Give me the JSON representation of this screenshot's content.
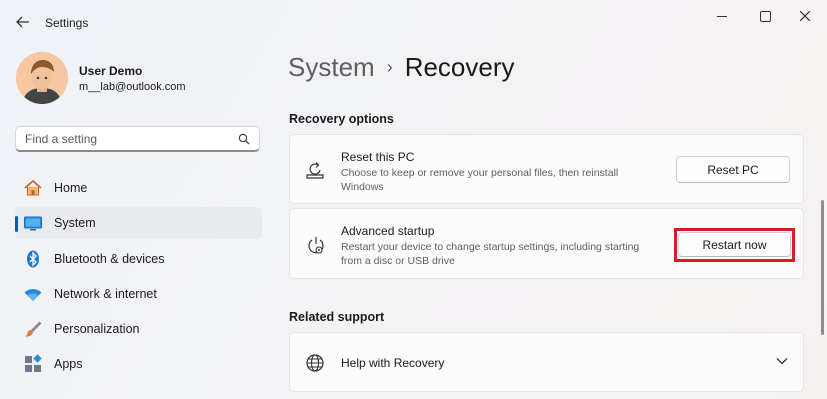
{
  "window": {
    "title": "Settings",
    "back_icon": "back-arrow-icon",
    "controls": [
      "minimize-icon",
      "maximize-icon",
      "close-icon"
    ]
  },
  "profile": {
    "name": "User Demo",
    "email": "m__lab@outlook.com"
  },
  "search": {
    "placeholder": "Find a setting",
    "value": "",
    "icon": "search-icon"
  },
  "sidebar": {
    "items": [
      {
        "label": "Home",
        "icon": "home-icon",
        "active": false
      },
      {
        "label": "System",
        "icon": "monitor-icon",
        "active": true
      },
      {
        "label": "Bluetooth & devices",
        "icon": "bluetooth-icon",
        "active": false
      },
      {
        "label": "Network & internet",
        "icon": "wifi-icon",
        "active": false
      },
      {
        "label": "Personalization",
        "icon": "paintbrush-icon",
        "active": false
      },
      {
        "label": "Apps",
        "icon": "apps-icon",
        "active": false
      }
    ]
  },
  "breadcrumb": {
    "parent": "System",
    "separator": "›",
    "current": "Recovery"
  },
  "recovery_options": {
    "header": "Recovery options",
    "items": [
      {
        "title": "Reset this PC",
        "description": "Choose to keep or remove your personal files, then reinstall Windows",
        "button": "Reset PC",
        "icon": "reset-pc-icon"
      },
      {
        "title": "Advanced startup",
        "description": "Restart your device to change startup settings, including starting from a disc or USB drive",
        "button": "Restart now",
        "icon": "advanced-startup-icon",
        "highlighted": true
      }
    ]
  },
  "related_support": {
    "header": "Related support",
    "items": [
      {
        "title": "Help with Recovery",
        "icon": "globe-icon",
        "expand_icon": "chevron-down-icon"
      }
    ]
  },
  "colors": {
    "accent": "#005fb8",
    "highlight": "#d41f2b",
    "card_background": "#fbfbfb"
  }
}
